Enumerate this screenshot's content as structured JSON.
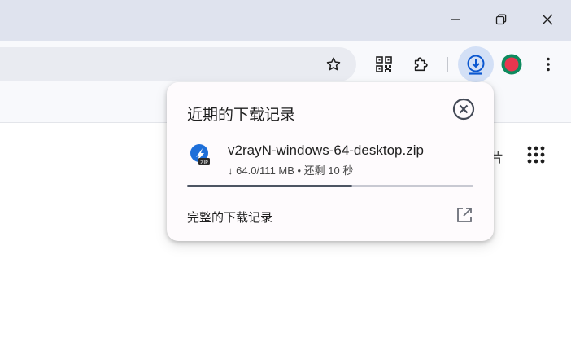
{
  "window_controls": {
    "minimize": "minimize-icon",
    "maximize": "restore-icon",
    "close": "close-icon"
  },
  "toolbar": {
    "bookmark_icon": "star-icon",
    "qr_icon": "qr-code-icon",
    "extensions_icon": "puzzle-icon",
    "download_icon": "download-icon",
    "profile_icon": "avatar",
    "menu_icon": "more-vert-icon"
  },
  "downloads_popup": {
    "title": "近期的下载记录",
    "item": {
      "filename": "v2rayN-windows-64-desktop.zip",
      "status_arrow": "↓",
      "status": "64.0/111 MB • 还剩 10 秒",
      "progress": 0.577
    },
    "full_history_label": "完整的下载记录"
  },
  "page": {
    "partial_char": "片"
  },
  "colors": {
    "titlebar": "#dfe3ee",
    "toolbar": "#f8f9fc",
    "accent": "#0b57d0",
    "progress": "#4d5563"
  }
}
